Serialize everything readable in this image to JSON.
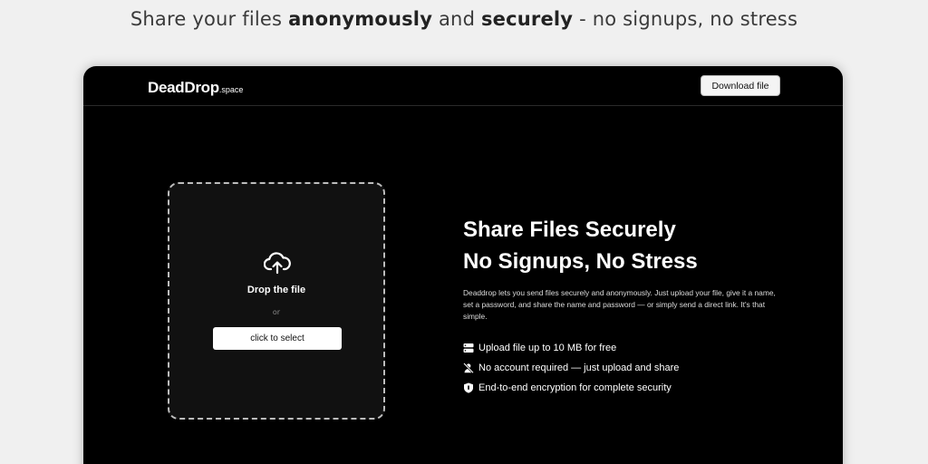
{
  "tagline": {
    "part1": "Share your files ",
    "bold1": "anonymously",
    "part2": " and ",
    "bold2": "securely",
    "part3": " - no signups, no stress"
  },
  "nav": {
    "logo_main": "DeadDrop",
    "logo_sub": ".space",
    "download_label": "Download file"
  },
  "dropzone": {
    "icon": "cloud-upload-icon",
    "title": "Drop the file",
    "or_text": "or",
    "select_label": "click to select"
  },
  "hero": {
    "title_line1": "Share Files Securely",
    "title_line2": "No Signups, No Stress",
    "description": "Deaddrop lets you send files securely and anonymously. Just upload your file, give it a name, set a password, and share the name and password — or simply send a direct link. It's that simple."
  },
  "features": [
    {
      "icon": "server-icon",
      "text": "Upload file up to 10 MB for free"
    },
    {
      "icon": "user-slash-icon",
      "text": "No account required — just upload and share"
    },
    {
      "icon": "shield-icon",
      "text": "End-to-end encryption for complete security"
    }
  ],
  "colors": {
    "page_bg": "#f0f0f0",
    "window_bg": "#000000",
    "dropzone_bg": "#111111",
    "dropzone_border": "#bdbdbd"
  }
}
